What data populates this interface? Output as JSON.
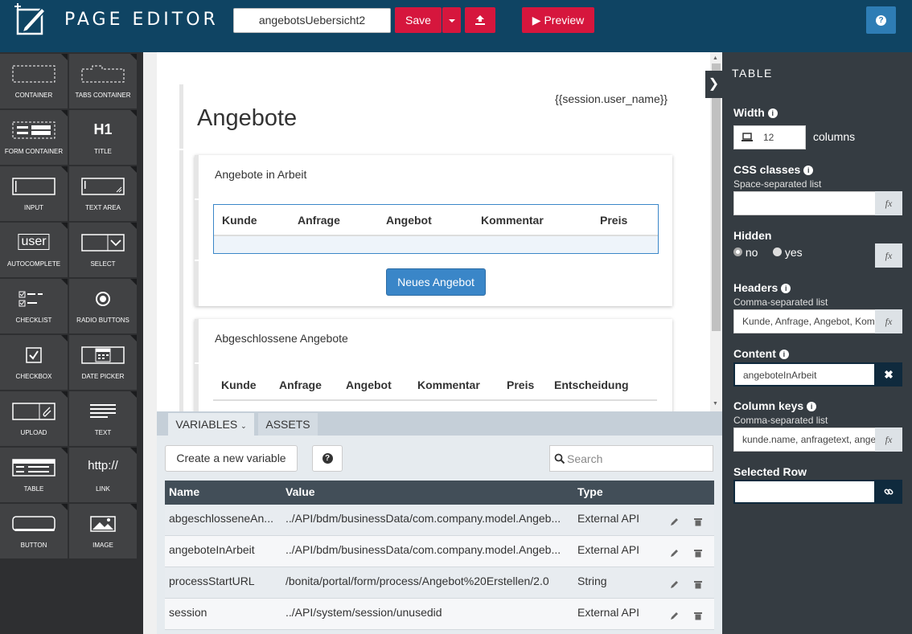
{
  "header": {
    "app_title": "PAGE EDITOR",
    "page_name": "angebotsUebersicht2",
    "save_label": "Save",
    "preview_label": "Preview"
  },
  "palette": {
    "items": [
      {
        "label": "CONTAINER",
        "icon": "container-icon"
      },
      {
        "label": "TABS CONTAINER",
        "icon": "tabs-container-icon"
      },
      {
        "label": "FORM CONTAINER",
        "icon": "form-container-icon"
      },
      {
        "label": "TITLE",
        "icon": "title-icon",
        "glyph": "H1"
      },
      {
        "label": "INPUT",
        "icon": "input-icon"
      },
      {
        "label": "TEXT AREA",
        "icon": "text-area-icon"
      },
      {
        "label": "AUTOCOMPLETE",
        "icon": "autocomplete-icon",
        "glyph": "user"
      },
      {
        "label": "SELECT",
        "icon": "select-icon"
      },
      {
        "label": "CHECKLIST",
        "icon": "checklist-icon"
      },
      {
        "label": "RADIO BUTTONS",
        "icon": "radio-buttons-icon"
      },
      {
        "label": "CHECKBOX",
        "icon": "checkbox-icon"
      },
      {
        "label": "DATE PICKER",
        "icon": "date-picker-icon"
      },
      {
        "label": "UPLOAD",
        "icon": "upload-icon"
      },
      {
        "label": "TEXT",
        "icon": "text-icon"
      },
      {
        "label": "TABLE",
        "icon": "table-icon"
      },
      {
        "label": "LINK",
        "icon": "link-icon",
        "glyph": "http://"
      },
      {
        "label": "BUTTON",
        "icon": "button-icon"
      },
      {
        "label": "IMAGE",
        "icon": "image-icon"
      }
    ]
  },
  "canvas": {
    "session_expr": "{{session.user_name}}",
    "title": "Angebote",
    "section1_title": "Angebote in Arbeit",
    "table1_headers": [
      "Kunde",
      "Anfrage",
      "Angebot",
      "Kommentar",
      "Preis"
    ],
    "new_offer_button": "Neues Angebot",
    "section2_title": "Abgeschlossene Angebote",
    "table2_headers": [
      "Kunde",
      "Anfrage",
      "Angebot",
      "Kommentar",
      "Preis",
      "Entscheidung"
    ]
  },
  "bottom_panel": {
    "tabs": [
      "VARIABLES",
      "ASSETS"
    ],
    "create_button": "Create a new variable",
    "search_placeholder": "Search",
    "columns": [
      "Name",
      "Value",
      "Type"
    ],
    "rows": [
      {
        "name": "abgeschlosseneAn...",
        "value": "../API/bdm/businessData/com.company.model.Angeb...",
        "type": "External API"
      },
      {
        "name": "angeboteInArbeit",
        "value": "../API/bdm/businessData/com.company.model.Angeb...",
        "type": "External API"
      },
      {
        "name": "processStartURL",
        "value": "/bonita/portal/form/process/Angebot%20Erstellen/2.0",
        "type": "String"
      },
      {
        "name": "session",
        "value": "../API/system/session/unusedid",
        "type": "External API"
      }
    ]
  },
  "properties": {
    "section_title": "TABLE",
    "width_label": "Width",
    "width_value": "12",
    "width_unit": "columns",
    "css_label": "CSS classes",
    "css_sub": "Space-separated list",
    "css_value": "",
    "hidden_label": "Hidden",
    "hidden_no": "no",
    "hidden_yes": "yes",
    "headers_label": "Headers",
    "headers_sub": "Comma-separated list",
    "headers_value": "Kunde, Anfrage, Angebot, Kommentar, Preis",
    "content_label": "Content",
    "content_value": "angeboteInArbeit",
    "colkeys_label": "Column keys",
    "colkeys_sub": "Comma-separated list",
    "colkeys_value": "kunde.name, anfragetext, angebot",
    "selected_label": "Selected Row",
    "selected_value": ""
  },
  "colors": {
    "header_bg": "#0f4463",
    "accent_red": "#d6163d",
    "panel_dark": "#353c42",
    "button_blue": "#3a86c8"
  }
}
